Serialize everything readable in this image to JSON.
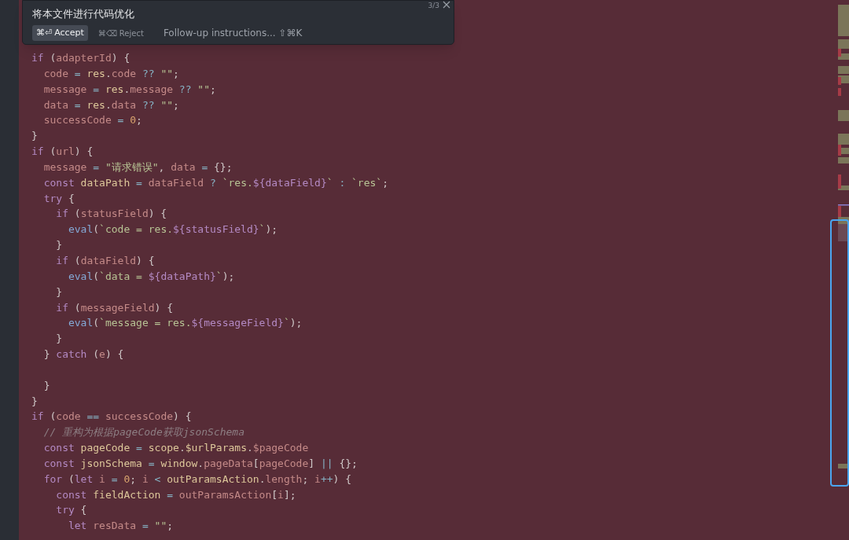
{
  "prompt_popup": {
    "title": "将本文件进行代码优化",
    "counter": "3/3",
    "accept": {
      "shortcut": "⌘⏎",
      "label": "Accept"
    },
    "reject": {
      "shortcut": "⌘⌫",
      "label": "Reject"
    },
    "followup": "Follow-up instructions... ⇧⌘K"
  },
  "code_lines": [
    {
      "kind": "code",
      "tokens": [
        {
          "kind": "k",
          "text": "if"
        },
        {
          "kind": "p",
          "text": " ("
        },
        {
          "kind": "v",
          "text": "adapterId"
        },
        {
          "kind": "p",
          "text": ") {"
        }
      ]
    },
    {
      "kind": "code",
      "tokens": [
        {
          "kind": "v",
          "text": "  code"
        },
        {
          "kind": "o",
          "text": " = "
        },
        {
          "kind": "i",
          "text": "res"
        },
        {
          "kind": "p",
          "text": "."
        },
        {
          "kind": "v",
          "text": "code"
        },
        {
          "kind": "o",
          "text": " ?? "
        },
        {
          "kind": "s",
          "text": "\"\""
        },
        {
          "kind": "p",
          "text": ";"
        }
      ]
    },
    {
      "kind": "code",
      "tokens": [
        {
          "kind": "v",
          "text": "  message"
        },
        {
          "kind": "o",
          "text": " = "
        },
        {
          "kind": "i",
          "text": "res"
        },
        {
          "kind": "p",
          "text": "."
        },
        {
          "kind": "v",
          "text": "message"
        },
        {
          "kind": "o",
          "text": " ?? "
        },
        {
          "kind": "s",
          "text": "\"\""
        },
        {
          "kind": "p",
          "text": ";"
        }
      ]
    },
    {
      "kind": "code",
      "tokens": [
        {
          "kind": "v",
          "text": "  data"
        },
        {
          "kind": "o",
          "text": " = "
        },
        {
          "kind": "i",
          "text": "res"
        },
        {
          "kind": "p",
          "text": "."
        },
        {
          "kind": "v",
          "text": "data"
        },
        {
          "kind": "o",
          "text": " ?? "
        },
        {
          "kind": "s",
          "text": "\"\""
        },
        {
          "kind": "p",
          "text": ";"
        }
      ]
    },
    {
      "kind": "code",
      "tokens": [
        {
          "kind": "v",
          "text": "  successCode"
        },
        {
          "kind": "o",
          "text": " = "
        },
        {
          "kind": "n",
          "text": "0"
        },
        {
          "kind": "p",
          "text": ";"
        }
      ]
    },
    {
      "kind": "code",
      "tokens": [
        {
          "kind": "p",
          "text": "}"
        }
      ]
    },
    {
      "kind": "code",
      "tokens": [
        {
          "kind": "k",
          "text": "if"
        },
        {
          "kind": "p",
          "text": " ("
        },
        {
          "kind": "v",
          "text": "url"
        },
        {
          "kind": "p",
          "text": ") {"
        }
      ]
    },
    {
      "kind": "code",
      "tokens": [
        {
          "kind": "v",
          "text": "  message"
        },
        {
          "kind": "o",
          "text": " = "
        },
        {
          "kind": "s",
          "text": "\"请求错误\""
        },
        {
          "kind": "p",
          "text": ", "
        },
        {
          "kind": "v",
          "text": "data"
        },
        {
          "kind": "o",
          "text": " = "
        },
        {
          "kind": "p",
          "text": "{};"
        }
      ]
    },
    {
      "kind": "code",
      "tokens": [
        {
          "kind": "k",
          "text": "  const"
        },
        {
          "kind": "i",
          "text": " dataPath"
        },
        {
          "kind": "o",
          "text": " = "
        },
        {
          "kind": "v",
          "text": "dataField"
        },
        {
          "kind": "o",
          "text": " ? "
        },
        {
          "kind": "s",
          "text": "`res."
        },
        {
          "kind": "t",
          "text": "${dataField}"
        },
        {
          "kind": "s",
          "text": "`"
        },
        {
          "kind": "o",
          "text": " : "
        },
        {
          "kind": "s",
          "text": "`res`"
        },
        {
          "kind": "p",
          "text": ";"
        }
      ]
    },
    {
      "kind": "code",
      "tokens": [
        {
          "kind": "k",
          "text": "  try"
        },
        {
          "kind": "p",
          "text": " {"
        }
      ]
    },
    {
      "kind": "code",
      "tokens": [
        {
          "kind": "k",
          "text": "    if"
        },
        {
          "kind": "p",
          "text": " ("
        },
        {
          "kind": "v",
          "text": "statusField"
        },
        {
          "kind": "p",
          "text": ") {"
        }
      ]
    },
    {
      "kind": "code",
      "tokens": [
        {
          "kind": "f",
          "text": "      eval"
        },
        {
          "kind": "p",
          "text": "("
        },
        {
          "kind": "s",
          "text": "`code = res."
        },
        {
          "kind": "t",
          "text": "${statusField}"
        },
        {
          "kind": "s",
          "text": "`"
        },
        {
          "kind": "p",
          "text": ");"
        }
      ]
    },
    {
      "kind": "code",
      "tokens": [
        {
          "kind": "p",
          "text": "    }"
        }
      ]
    },
    {
      "kind": "code",
      "tokens": [
        {
          "kind": "k",
          "text": "    if"
        },
        {
          "kind": "p",
          "text": " ("
        },
        {
          "kind": "v",
          "text": "dataField"
        },
        {
          "kind": "p",
          "text": ") {"
        }
      ]
    },
    {
      "kind": "code",
      "tokens": [
        {
          "kind": "f",
          "text": "      eval"
        },
        {
          "kind": "p",
          "text": "("
        },
        {
          "kind": "s",
          "text": "`data = "
        },
        {
          "kind": "t",
          "text": "${dataPath}"
        },
        {
          "kind": "s",
          "text": "`"
        },
        {
          "kind": "p",
          "text": ");"
        }
      ]
    },
    {
      "kind": "code",
      "tokens": [
        {
          "kind": "p",
          "text": "    }"
        }
      ]
    },
    {
      "kind": "code",
      "tokens": [
        {
          "kind": "k",
          "text": "    if"
        },
        {
          "kind": "p",
          "text": " ("
        },
        {
          "kind": "v",
          "text": "messageField"
        },
        {
          "kind": "p",
          "text": ") {"
        }
      ]
    },
    {
      "kind": "code",
      "tokens": [
        {
          "kind": "f",
          "text": "      eval"
        },
        {
          "kind": "p",
          "text": "("
        },
        {
          "kind": "s",
          "text": "`message = res."
        },
        {
          "kind": "t",
          "text": "${messageField}"
        },
        {
          "kind": "s",
          "text": "`"
        },
        {
          "kind": "p",
          "text": ");"
        }
      ]
    },
    {
      "kind": "code",
      "tokens": [
        {
          "kind": "p",
          "text": "    }"
        }
      ]
    },
    {
      "kind": "code",
      "tokens": [
        {
          "kind": "p",
          "text": "  } "
        },
        {
          "kind": "k",
          "text": "catch"
        },
        {
          "kind": "p",
          "text": " ("
        },
        {
          "kind": "v",
          "text": "e"
        },
        {
          "kind": "p",
          "text": ") {"
        }
      ]
    },
    {
      "kind": "blank"
    },
    {
      "kind": "code",
      "tokens": [
        {
          "kind": "p",
          "text": "  }"
        }
      ]
    },
    {
      "kind": "code",
      "tokens": [
        {
          "kind": "p",
          "text": "}"
        }
      ]
    },
    {
      "kind": "code",
      "tokens": [
        {
          "kind": "k",
          "text": "if"
        },
        {
          "kind": "p",
          "text": " ("
        },
        {
          "kind": "v",
          "text": "code"
        },
        {
          "kind": "o",
          "text": " == "
        },
        {
          "kind": "v",
          "text": "successCode"
        },
        {
          "kind": "p",
          "text": ") {"
        }
      ]
    },
    {
      "kind": "code",
      "tokens": [
        {
          "kind": "c",
          "text": "  // 重构为根据pageCode获取jsonSchema"
        }
      ]
    },
    {
      "kind": "code",
      "tokens": [
        {
          "kind": "k",
          "text": "  const"
        },
        {
          "kind": "i",
          "text": " pageCode"
        },
        {
          "kind": "o",
          "text": " = "
        },
        {
          "kind": "i",
          "text": "scope"
        },
        {
          "kind": "p",
          "text": "."
        },
        {
          "kind": "i",
          "text": "$urlParams"
        },
        {
          "kind": "p",
          "text": "."
        },
        {
          "kind": "v",
          "text": "$pageCode"
        }
      ]
    },
    {
      "kind": "code",
      "tokens": [
        {
          "kind": "k",
          "text": "  const"
        },
        {
          "kind": "i",
          "text": " jsonSchema"
        },
        {
          "kind": "o",
          "text": " = "
        },
        {
          "kind": "i",
          "text": "window"
        },
        {
          "kind": "p",
          "text": "."
        },
        {
          "kind": "v",
          "text": "pageData"
        },
        {
          "kind": "p",
          "text": "["
        },
        {
          "kind": "v",
          "text": "pageCode"
        },
        {
          "kind": "p",
          "text": "]"
        },
        {
          "kind": "o",
          "text": " || "
        },
        {
          "kind": "p",
          "text": "{};"
        }
      ]
    },
    {
      "kind": "code",
      "tokens": [
        {
          "kind": "k",
          "text": "  for"
        },
        {
          "kind": "p",
          "text": " ("
        },
        {
          "kind": "k",
          "text": "let"
        },
        {
          "kind": "v",
          "text": " i"
        },
        {
          "kind": "o",
          "text": " = "
        },
        {
          "kind": "n",
          "text": "0"
        },
        {
          "kind": "p",
          "text": "; "
        },
        {
          "kind": "v",
          "text": "i"
        },
        {
          "kind": "o",
          "text": " < "
        },
        {
          "kind": "i",
          "text": "outParamsAction"
        },
        {
          "kind": "p",
          "text": "."
        },
        {
          "kind": "v",
          "text": "length"
        },
        {
          "kind": "p",
          "text": "; "
        },
        {
          "kind": "v",
          "text": "i"
        },
        {
          "kind": "o",
          "text": "++"
        },
        {
          "kind": "p",
          "text": ") {"
        }
      ]
    },
    {
      "kind": "code",
      "tokens": [
        {
          "kind": "k",
          "text": "    const"
        },
        {
          "kind": "i",
          "text": " fieldAction"
        },
        {
          "kind": "o",
          "text": " = "
        },
        {
          "kind": "v",
          "text": "outParamsAction"
        },
        {
          "kind": "p",
          "text": "["
        },
        {
          "kind": "v",
          "text": "i"
        },
        {
          "kind": "p",
          "text": "];"
        }
      ]
    },
    {
      "kind": "code",
      "tokens": [
        {
          "kind": "k",
          "text": "    try"
        },
        {
          "kind": "p",
          "text": " {"
        }
      ]
    },
    {
      "kind": "code",
      "tokens": [
        {
          "kind": "k",
          "text": "      let"
        },
        {
          "kind": "v",
          "text": " resData"
        },
        {
          "kind": "o",
          "text": " = "
        },
        {
          "kind": "s",
          "text": "\"\""
        },
        {
          "kind": "p",
          "text": ";"
        }
      ]
    }
  ]
}
